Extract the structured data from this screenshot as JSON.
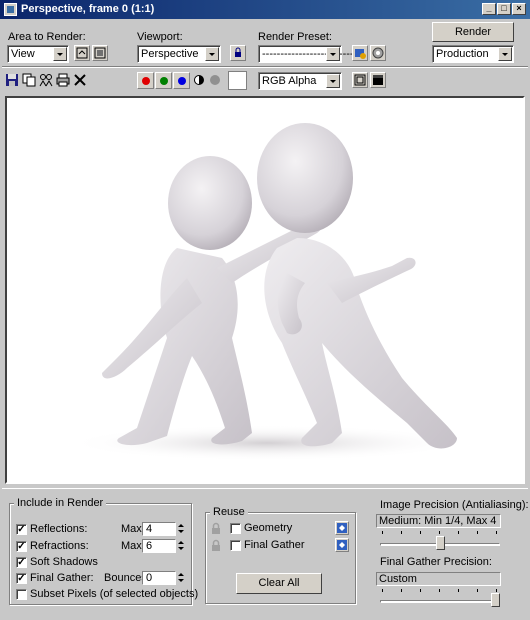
{
  "window": {
    "title": "Perspective, frame 0 (1:1)"
  },
  "toolbar": {
    "area_label": "Area to Render:",
    "area_value": "View",
    "viewport_label": "Viewport:",
    "viewport_value": "Perspective",
    "preset_label": "Render Preset:",
    "preset_value": "-------------------------",
    "render_button": "Render",
    "production_value": "Production",
    "channel_value": "RGB Alpha"
  },
  "include_in_render": {
    "title": "Include in Render",
    "reflections": {
      "label": "Reflections:",
      "checked": true,
      "max_label": "Max:",
      "max": "4"
    },
    "refractions": {
      "label": "Refractions:",
      "checked": true,
      "max_label": "Max:",
      "max": "6"
    },
    "soft_shadows": {
      "label": "Soft Shadows",
      "checked": true
    },
    "final_gather": {
      "label": "Final Gather:",
      "checked": true,
      "bounces_label": "Bounces:",
      "bounces": "0"
    },
    "subset_pixels": {
      "label": "Subset Pixels (of selected objects)",
      "checked": false
    }
  },
  "reuse": {
    "title": "Reuse",
    "geometry": {
      "label": "Geometry",
      "checked": false
    },
    "final_gather": {
      "label": "Final Gather",
      "checked": false
    },
    "clear_all": "Clear All"
  },
  "image_precision": {
    "label": "Image Precision (Antialiasing):",
    "value": "Medium: Min 1/4, Max 4",
    "level": 0.5
  },
  "final_gather_precision": {
    "label": "Final Gather Precision:",
    "value": "Custom",
    "level": 1.0
  }
}
